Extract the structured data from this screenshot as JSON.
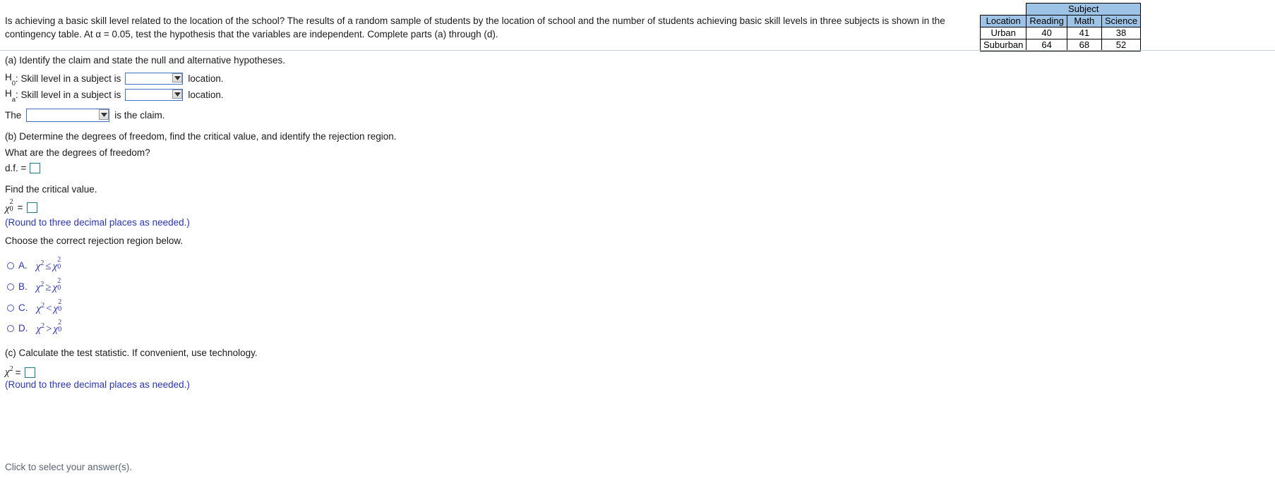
{
  "question": {
    "text": "Is achieving a basic skill level related to the location of the school? The results of a random sample of students by the location of school and the number of students achieving basic skill levels in three subjects is shown in the contingency table. At α = 0.05, test the hypothesis that the variables are independent. Complete parts (a) through (d)."
  },
  "contingency_table": {
    "group_header": "Subject",
    "columns": [
      "Location",
      "Reading",
      "Math",
      "Science"
    ],
    "rows": [
      {
        "label": "Urban",
        "values": [
          "40",
          "41",
          "38"
        ]
      },
      {
        "label": "Suburban",
        "values": [
          "64",
          "68",
          "52"
        ]
      }
    ],
    "header_bg": "#9dc3e6"
  },
  "part_a": {
    "prompt": "(a) Identify the claim and state the null and alternative hypotheses.",
    "h0_label": "H",
    "h0_sub": "0",
    "h0_text_before": ": Skill level in a subject is",
    "h0_text_after": "location.",
    "ha_label": "H",
    "ha_sub": "a",
    "ha_text_before": ": Skill level in a subject is",
    "ha_text_after": "location.",
    "dropdown_value": "",
    "claim_prefix": "The",
    "claim_suffix": "is the claim.",
    "claim_dropdown_value": ""
  },
  "part_b": {
    "prompt": "(b) Determine the degrees of freedom, find the critical value, and identify the rejection region.",
    "df_question": "What are the degrees of freedom?",
    "df_label": "d.f. =",
    "df_value": "",
    "critical_prompt": "Find the critical value.",
    "chi_crit_label": "χ",
    "chi_crit_sup": "2",
    "chi_crit_sub": "0",
    "chi_crit_eq": "=",
    "chi_crit_value": "",
    "round_note": "(Round to three decimal places as needed.)",
    "choose_prompt": "Choose the correct rejection region below.",
    "options": [
      {
        "letter": "A.",
        "left": "χ",
        "left_sup": "2",
        "operator": "≤",
        "right": "χ",
        "right_sup": "2",
        "right_sub": "0",
        "selected": false
      },
      {
        "letter": "B.",
        "left": "χ",
        "left_sup": "2",
        "operator": "≥",
        "right": "χ",
        "right_sup": "2",
        "right_sub": "0",
        "selected": false
      },
      {
        "letter": "C.",
        "left": "χ",
        "left_sup": "2",
        "operator": "<",
        "right": "χ",
        "right_sup": "2",
        "right_sub": "0",
        "selected": false
      },
      {
        "letter": "D.",
        "left": "χ",
        "left_sup": "2",
        "operator": ">",
        "right": "χ",
        "right_sup": "2",
        "right_sub": "0",
        "selected": false
      }
    ]
  },
  "part_c": {
    "prompt": "(c) Calculate the test statistic. If convenient, use technology.",
    "chi_label": "χ",
    "chi_sup": "2",
    "chi_eq": "=",
    "chi_value": "",
    "round_note": "(Round to three decimal places as needed.)"
  },
  "footer": {
    "note": "Click to select your answer(s)."
  },
  "colors": {
    "blue_text": "#2b35af",
    "dropdown_border": "#3f72c4",
    "input_border": "#1d7a87",
    "table_header": "#9dc3e6",
    "divider": "#c9d3de",
    "footer_text": "#5a6472"
  }
}
